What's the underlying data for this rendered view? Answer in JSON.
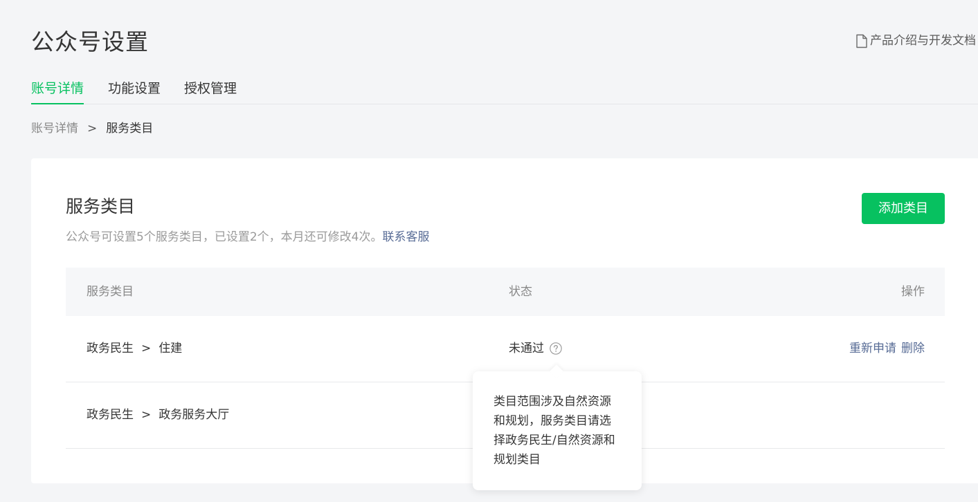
{
  "header": {
    "title": "公众号设置",
    "doc_link": "产品介绍与开发文档"
  },
  "tabs": [
    {
      "label": "账号详情",
      "active": true
    },
    {
      "label": "功能设置",
      "active": false
    },
    {
      "label": "授权管理",
      "active": false
    }
  ],
  "breadcrumb": {
    "parent": "账号详情",
    "separator": ">",
    "current": "服务类目"
  },
  "card": {
    "title": "服务类目",
    "description": "公众号可设置5个服务类目，已设置2个，本月还可修改4次。",
    "contact_link": "联系客服",
    "add_button": "添加类目"
  },
  "table": {
    "headers": {
      "category": "服务类目",
      "status": "状态",
      "actions": "操作"
    },
    "rows": [
      {
        "parent": "政务民生",
        "separator": ">",
        "child": "住建",
        "status": "未通过",
        "actions": [
          "重新申请",
          "删除"
        ]
      },
      {
        "parent": "政务民生",
        "separator": ">",
        "child": "政务服务大厅",
        "status": "",
        "actions": []
      }
    ]
  },
  "tooltip": {
    "text": "类目范围涉及自然资源和规划，服务类目请选择政务民生/自然资源和规划类目"
  },
  "colors": {
    "accent": "#07c160",
    "link": "#576b95",
    "background": "#f4f5f7"
  }
}
